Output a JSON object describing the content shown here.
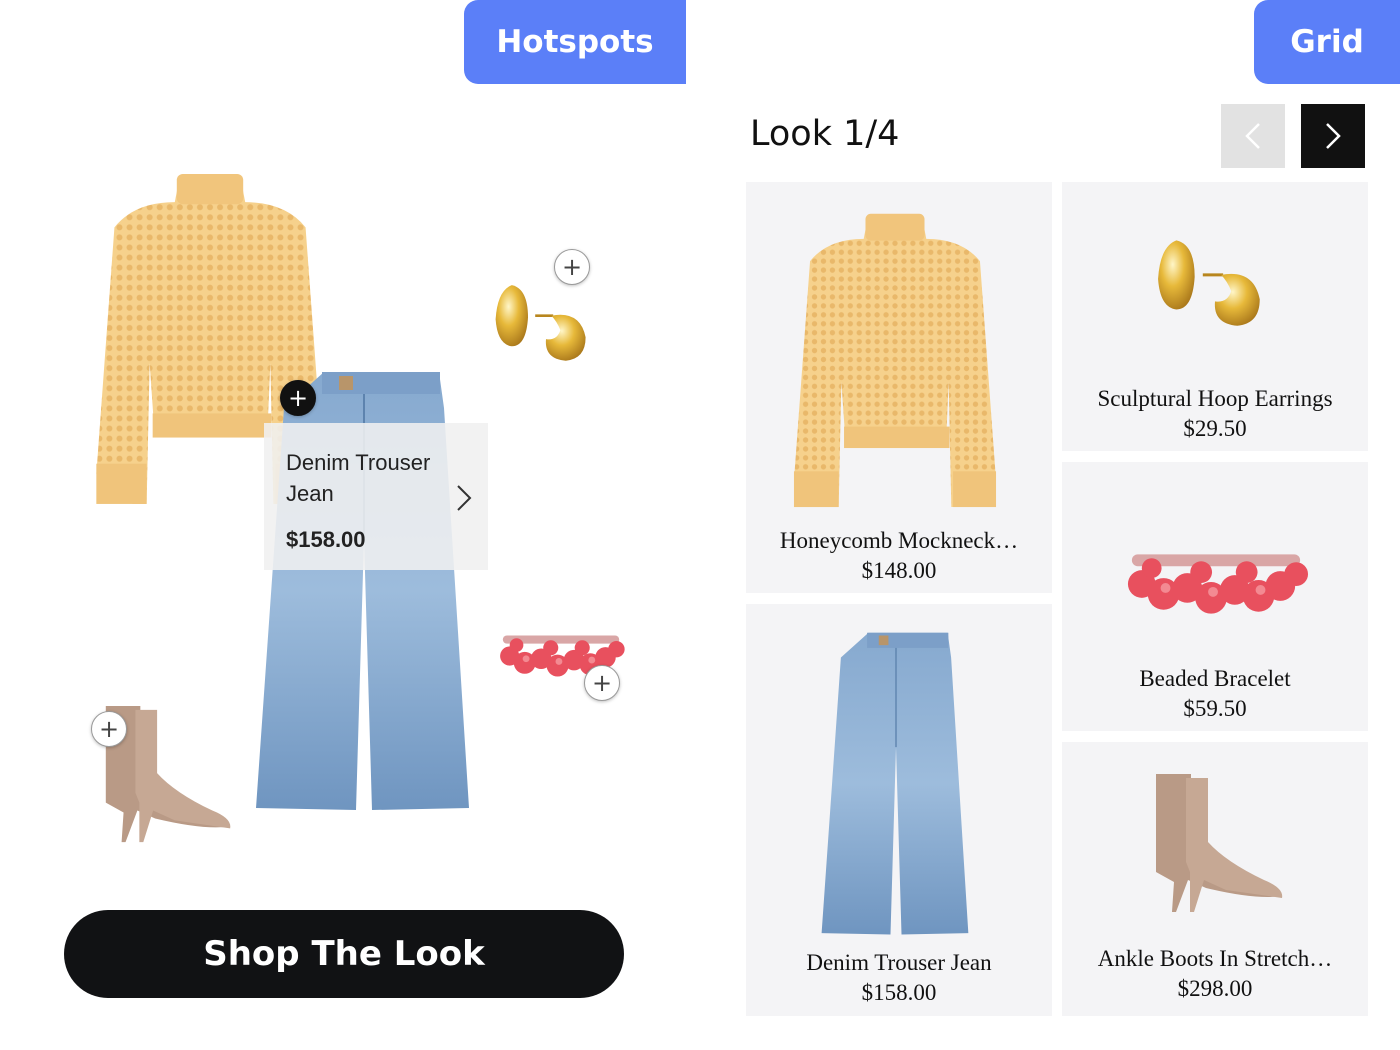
{
  "tabs": {
    "hotspots": "Hotspots",
    "grid": "Grid"
  },
  "hotspot_view": {
    "popup": {
      "name": "Denim Trouser Jean",
      "price": "$158.00"
    },
    "cta": "Shop The Look",
    "hotspot_symbol": "+"
  },
  "grid_view": {
    "look_label": "Look 1/4",
    "products": [
      {
        "name": "Honeycomb Mockneck…",
        "price": "$148.00",
        "icon": "sweater-image"
      },
      {
        "name": "Sculptural Hoop Earrings",
        "price": "$29.50",
        "icon": "earrings-image"
      },
      {
        "name": "Beaded Bracelet",
        "price": "$59.50",
        "icon": "bracelet-image"
      },
      {
        "name": "Denim Trouser Jean",
        "price": "$158.00",
        "icon": "jeans-image"
      },
      {
        "name": "Ankle Boots In Stretch…",
        "price": "$298.00",
        "icon": "boots-image"
      }
    ]
  },
  "colors": {
    "accent": "#5b7ff8",
    "dark": "#111214",
    "card_bg": "#f4f4f6"
  }
}
